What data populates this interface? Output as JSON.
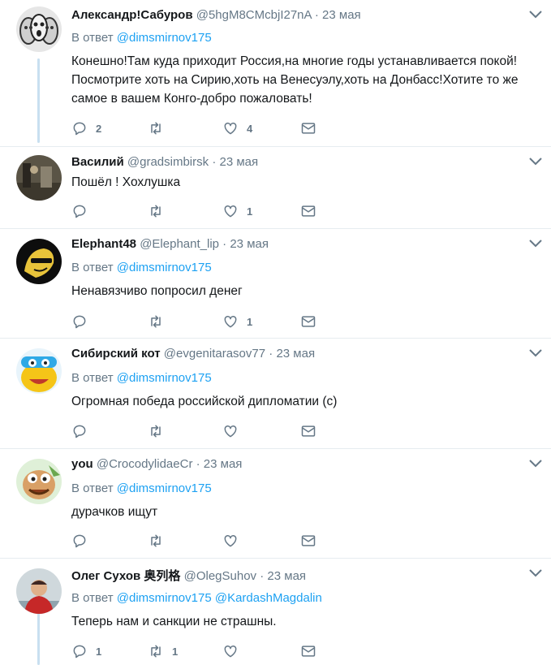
{
  "tweets": [
    {
      "name": "Александр!Сабуров",
      "handle": "@5hgM8CMcbjI27nA",
      "time": "23 мая",
      "reply_label": "В ответ",
      "reply_to": [
        "@dimsmirnov175"
      ],
      "text": "Конешно!Там куда приходит Россия,на многие годы устанавливается покой! Посмотрите хоть на Сирию,хоть на Венесуэлу,хоть на Донбасс!Хотите то же самое в вашем Конго-добро пожаловать!",
      "counts": {
        "reply": "2",
        "retweet": "",
        "like": "4"
      },
      "avatar_colors": [
        "#d8d8d8",
        "#333333"
      ]
    },
    {
      "name": "Василий",
      "handle": "@gradsimbirsk",
      "time": "23 мая",
      "reply_label": "",
      "reply_to": [],
      "text": "Пошёл ! Хохлушка",
      "counts": {
        "reply": "",
        "retweet": "",
        "like": "1"
      },
      "avatar_colors": [
        "#4a4436",
        "#8a8270"
      ]
    },
    {
      "name": "Elephant48",
      "handle": "@Elephant_lip",
      "time": "23 мая",
      "reply_label": "В ответ",
      "reply_to": [
        "@dimsmirnov175"
      ],
      "text": "Ненавязчиво попросил денег",
      "counts": {
        "reply": "",
        "retweet": "",
        "like": "1"
      },
      "avatar_colors": [
        "#111111",
        "#e8c33a"
      ]
    },
    {
      "name": "Сибирский кот",
      "handle": "@evgenitarasov77",
      "time": "23 мая",
      "reply_label": "В ответ",
      "reply_to": [
        "@dimsmirnov175"
      ],
      "text": "Огромная победа российской дипломатии (с)",
      "counts": {
        "reply": "",
        "retweet": "",
        "like": ""
      },
      "avatar_colors": [
        "#2fa9e6",
        "#f5c518"
      ]
    },
    {
      "name": "you",
      "handle": "@CrocodylidaeCr",
      "time": "23 мая",
      "reply_label": "В ответ",
      "reply_to": [
        "@dimsmirnov175"
      ],
      "text": "дурачков ищут",
      "counts": {
        "reply": "",
        "retweet": "",
        "like": ""
      },
      "avatar_colors": [
        "#6aa84f",
        "#d9a066"
      ]
    },
    {
      "name": "Олег Сухов 奥列格",
      "handle": "@OlegSuhov",
      "time": "23 мая",
      "reply_label": "В ответ",
      "reply_to": [
        "@dimsmirnov175",
        "@KardashMagdalin"
      ],
      "text": "Теперь нам и санкции не страшны.",
      "counts": {
        "reply": "1",
        "retweet": "1",
        "like": ""
      },
      "avatar_colors": [
        "#c62828",
        "#cfd8dc"
      ]
    }
  ],
  "icons": {
    "reply": "reply-icon",
    "retweet": "retweet-icon",
    "like": "like-icon",
    "dm": "direct-message-icon",
    "menu": "chevron-down-icon"
  },
  "colors": {
    "link": "#1da1f2",
    "secondary": "#657786",
    "thread_line": "#c8dff0",
    "divider": "#e6ecf0"
  }
}
